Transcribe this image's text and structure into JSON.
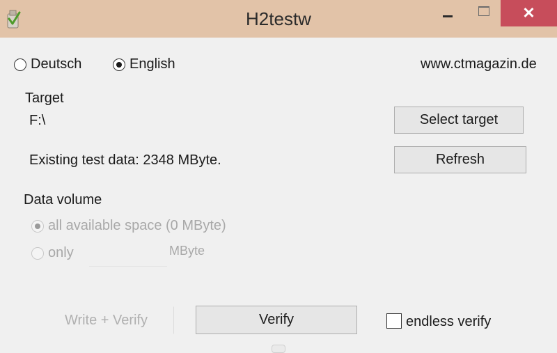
{
  "window": {
    "title": "H2testw",
    "close_glyph": "✕"
  },
  "icons": {
    "app": "h2testw-app-icon",
    "minimize": "minimize-icon",
    "maximize": "maximize-icon",
    "close": "close-icon"
  },
  "language": {
    "deutsch": "Deutsch",
    "english": "English",
    "selected": "English"
  },
  "website": "www.ctmagazin.de",
  "target": {
    "label": "Target",
    "path": "F:\\",
    "select_button": "Select target"
  },
  "existing": {
    "text": "Existing test data: 2348 MByte.",
    "refresh_button": "Refresh"
  },
  "volume": {
    "label": "Data volume",
    "all_option": "all available space (0 MByte)",
    "only_option": "only",
    "unit": "MByte",
    "only_value": ""
  },
  "actions": {
    "write_verify": "Write + Verify",
    "verify": "Verify",
    "endless_label": "endless verify",
    "endless_checked": false
  }
}
